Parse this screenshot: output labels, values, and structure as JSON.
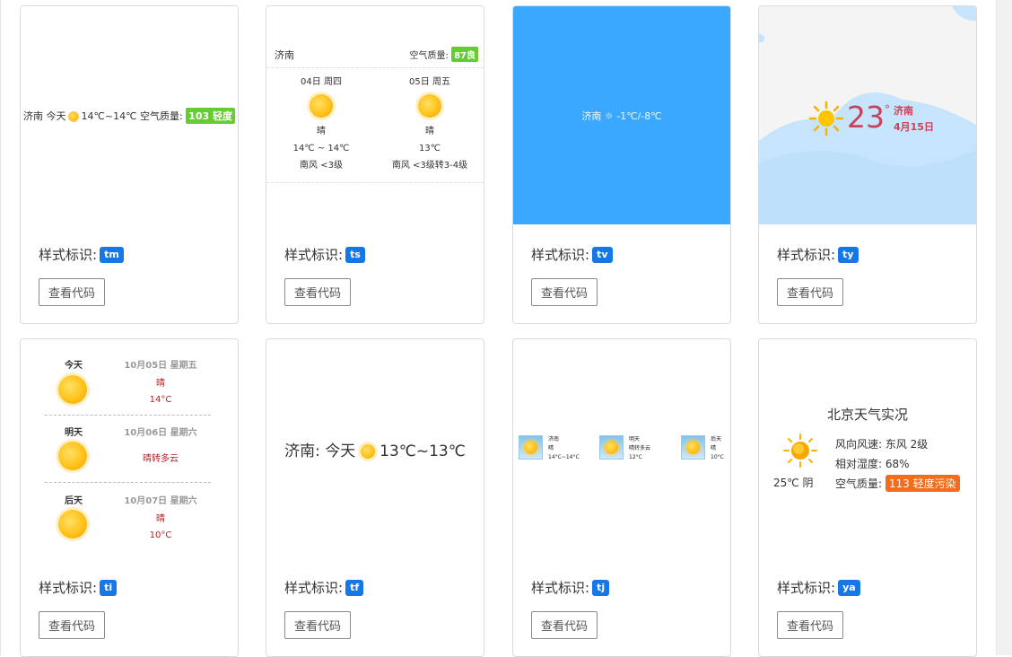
{
  "label_prefix": "样式标识:",
  "btn_label": "查看代码",
  "cards": {
    "tm": {
      "badge": "tm",
      "city": "济南",
      "day": "今天",
      "temp": "14℃~14℃",
      "aqi_label": "空气质量:",
      "aqi_value": "103 轻度"
    },
    "ts": {
      "badge": "ts",
      "city": "济南",
      "aqi_label": "空气质量:",
      "aqi_value": "87良",
      "days": [
        {
          "date": "04日 周四",
          "weather": "晴",
          "temp": "14℃ ~ 14℃",
          "wind": "南风 <3级"
        },
        {
          "date": "05日 周五",
          "weather": "晴",
          "temp": "13℃",
          "wind": "南风 <3级转3-4级"
        }
      ]
    },
    "tv": {
      "badge": "tv",
      "text": "济南 ☼ -1℃/-8℃"
    },
    "ty": {
      "badge": "ty",
      "temp": "23",
      "deg": "°",
      "city": "济南",
      "date": "4月15日"
    },
    "ti": {
      "badge": "ti",
      "days": [
        {
          "day": "今天",
          "date": "10月05日 星期五",
          "weather": "晴",
          "temp": "14°C"
        },
        {
          "day": "明天",
          "date": "10月06日 星期六",
          "weather": "晴转多云",
          "temp": ""
        },
        {
          "day": "后天",
          "date": "10月07日 星期六",
          "weather": "晴",
          "temp": "10°C"
        }
      ]
    },
    "tf": {
      "badge": "tf",
      "city": "济南:",
      "day": "今天",
      "temp": "13℃~13℃"
    },
    "tj": {
      "badge": "tj",
      "items": [
        {
          "l1": "济南",
          "l2": "晴",
          "l3": "14°C~14°C"
        },
        {
          "l1": "明天",
          "l2": "晴转多云",
          "l3": "12°C"
        },
        {
          "l1": "后天",
          "l2": "晴",
          "l3": "10°C"
        }
      ]
    },
    "ya": {
      "badge": "ya",
      "title": "北京天气实况",
      "temp": "25℃ 阴",
      "wind": "风向风速: 东风 2级",
      "humidity": "相对湿度: 68%",
      "aqi_label": "空气质量:",
      "aqi_value": "113 轻度污染"
    }
  }
}
